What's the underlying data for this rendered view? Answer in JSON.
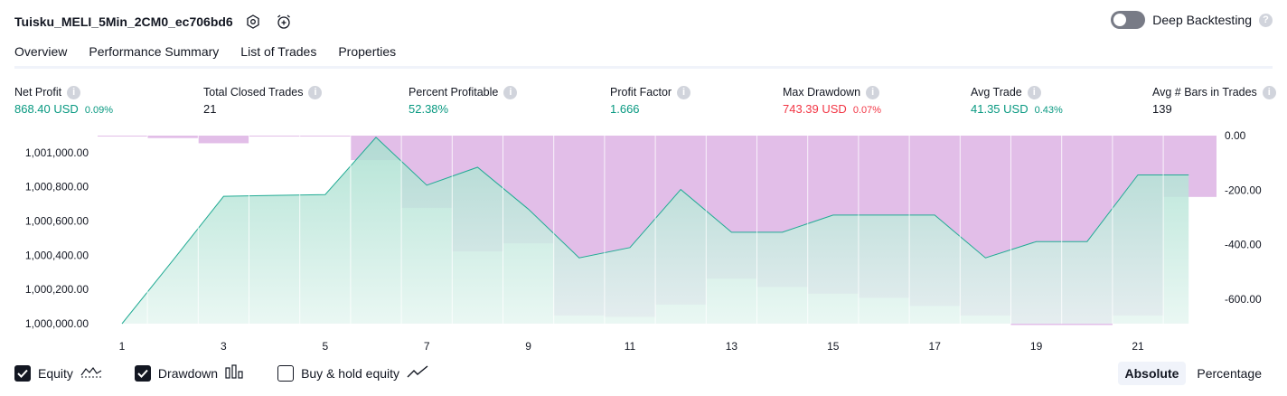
{
  "header": {
    "strategy_name": "Tuisku_MELI_5Min_2CM0_ec706bd6",
    "settings_icon": "settings-hexagon-icon",
    "alert_icon": "alarm-clock-plus-icon",
    "deep_backtesting": {
      "label": "Deep Backtesting",
      "enabled": false
    }
  },
  "tabs": [
    {
      "label": "Overview",
      "active": true
    },
    {
      "label": "Performance Summary",
      "active": false
    },
    {
      "label": "List of Trades",
      "active": false
    },
    {
      "label": "Properties",
      "active": false
    }
  ],
  "stats": [
    {
      "label": "Net Profit",
      "value": "868.40 USD",
      "pct": "0.09%",
      "tone": "green"
    },
    {
      "label": "Total Closed Trades",
      "value": "21",
      "pct": "",
      "tone": "dark"
    },
    {
      "label": "Percent Profitable",
      "value": "52.38%",
      "pct": "",
      "tone": "green"
    },
    {
      "label": "Profit Factor",
      "value": "1.666",
      "pct": "",
      "tone": "green"
    },
    {
      "label": "Max Drawdown",
      "value": "743.39 USD",
      "pct": "0.07%",
      "tone": "red"
    },
    {
      "label": "Avg Trade",
      "value": "41.35 USD",
      "pct": "0.43%",
      "tone": "green"
    },
    {
      "label": "Avg # Bars in Trades",
      "value": "139",
      "pct": "",
      "tone": "dark"
    }
  ],
  "chart_data": {
    "type": "area",
    "x_ticks": [
      "1",
      "3",
      "5",
      "7",
      "9",
      "11",
      "13",
      "15",
      "17",
      "19",
      "21"
    ],
    "y_left_ticks": [
      "1,001,000.00",
      "1,000,800.00",
      "1,000,600.00",
      "1,000,400.00",
      "1,000,200.00",
      "1,000,000.00"
    ],
    "y_left_range": [
      1000000,
      1001100
    ],
    "y_right_ticks": [
      "0.00",
      "-200.00",
      "-400.00",
      "-600.00"
    ],
    "y_right_range": [
      -690,
      0
    ],
    "series": [
      {
        "name": "Equity",
        "type": "line-area",
        "color": "#22ab94",
        "x": [
          1,
          2,
          3,
          4,
          5,
          6,
          7,
          8,
          9,
          10,
          11,
          12,
          13,
          14,
          15,
          16,
          17,
          18,
          19,
          20,
          21,
          22
        ],
        "values": [
          1000000,
          1000370,
          1000745,
          1000750,
          1000755,
          1001090,
          1000810,
          1000915,
          1000670,
          1000385,
          1000445,
          1000785,
          1000535,
          1000535,
          1000635,
          1000635,
          1000635,
          1000385,
          1000480,
          1000480,
          1000870,
          1000870
        ]
      },
      {
        "name": "Drawdown",
        "type": "bar",
        "color": "#ce93d8",
        "x": [
          1,
          2,
          3,
          4,
          5,
          6,
          7,
          8,
          9,
          10,
          11,
          12,
          13,
          14,
          15,
          16,
          17,
          18,
          19,
          20,
          21,
          22
        ],
        "values": [
          -2,
          -9,
          -28,
          -2,
          -2,
          -90,
          -265,
          -425,
          -395,
          -660,
          -665,
          -620,
          -525,
          -555,
          -580,
          -595,
          -625,
          -660,
          -695,
          -695,
          -660,
          -225
        ]
      }
    ]
  },
  "legend": [
    {
      "label": "Equity",
      "checked": true,
      "icon": "equity-line-icon"
    },
    {
      "label": "Drawdown",
      "checked": true,
      "icon": "drawdown-bars-icon"
    },
    {
      "label": "Buy & hold equity",
      "checked": false,
      "icon": "buy-hold-line-icon"
    }
  ],
  "mode": {
    "absolute": "Absolute",
    "percentage": "Percentage",
    "selected": "Absolute"
  }
}
